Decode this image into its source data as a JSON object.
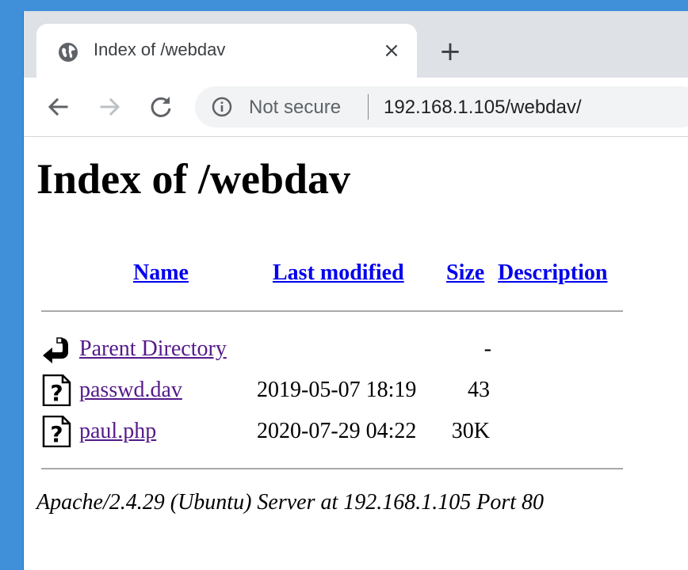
{
  "browser": {
    "tab": {
      "title": "Index of /webdav",
      "favicon": "globe-icon",
      "close_label": "×"
    },
    "new_tab_label": "+",
    "toolbar": {
      "back_icon": "arrow-left-icon",
      "forward_icon": "arrow-right-icon",
      "reload_icon": "reload-icon"
    },
    "omnibox": {
      "security_icon": "info-icon",
      "security_label": "Not secure",
      "url": "192.168.1.105/webdav/"
    }
  },
  "page": {
    "title": "Index of /webdav",
    "columns": {
      "name": "Name",
      "last_modified": "Last modified",
      "size": "Size",
      "description": "Description"
    },
    "rows": [
      {
        "icon": "back-arrow-icon",
        "name": "Parent Directory",
        "last_modified": "",
        "size": "-",
        "description": ""
      },
      {
        "icon": "unknown-file-icon",
        "name": "passwd.dav",
        "last_modified": "2019-05-07 18:19",
        "size": "43",
        "description": ""
      },
      {
        "icon": "unknown-file-icon",
        "name": "paul.php",
        "last_modified": "2020-07-29 04:22",
        "size": "30K",
        "description": ""
      }
    ],
    "server_signature": "Apache/2.4.29 (Ubuntu) Server at 192.168.1.105 Port 80"
  },
  "colors": {
    "link": "#0000ee",
    "visited_link": "#551a8b",
    "desktop": "#3f8fd9",
    "tabstrip": "#dee1e6"
  }
}
